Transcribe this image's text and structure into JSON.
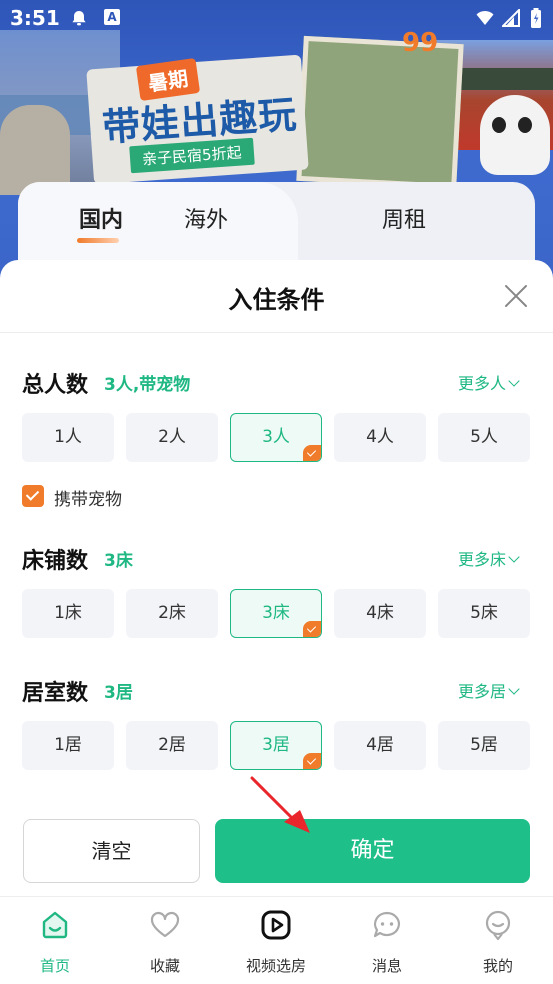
{
  "status_bar": {
    "time": "3:51",
    "a_icon_text": "A"
  },
  "banner": {
    "summer_tag": "暑期",
    "slogan": "带娃出趣玩",
    "sub_slogan": "亲子民宿5折起",
    "quote_mark": "99"
  },
  "tabs": [
    {
      "label": "国内",
      "active": true
    },
    {
      "label": "海外",
      "active": false
    },
    {
      "label": "周租",
      "active": false
    }
  ],
  "sheet": {
    "title": "入住条件",
    "sections": {
      "guests": {
        "title": "总人数",
        "value": "3人,带宠物",
        "more": "更多人",
        "options": [
          "1人",
          "2人",
          "3人",
          "4人",
          "5人"
        ],
        "selected_index": 2
      },
      "beds": {
        "title": "床铺数",
        "value": "3床",
        "more": "更多床",
        "options": [
          "1床",
          "2床",
          "3床",
          "4床",
          "5床"
        ],
        "selected_index": 2
      },
      "rooms": {
        "title": "居室数",
        "value": "3居",
        "more": "更多居",
        "options": [
          "1居",
          "2居",
          "3居",
          "4居",
          "5居"
        ],
        "selected_index": 2
      }
    },
    "pet": {
      "label": "携带宠物",
      "checked": true
    },
    "buttons": {
      "clear": "清空",
      "confirm": "确定"
    }
  },
  "bottom_nav": [
    {
      "label": "首页",
      "icon": "home-icon",
      "active": true
    },
    {
      "label": "收藏",
      "icon": "heart-icon",
      "active": false
    },
    {
      "label": "视频选房",
      "icon": "video-play-icon",
      "active": false
    },
    {
      "label": "消息",
      "icon": "message-icon",
      "active": false
    },
    {
      "label": "我的",
      "icon": "profile-icon",
      "active": false
    }
  ],
  "colors": {
    "accent_green": "#1fb883",
    "confirm_green": "#1fbf8a",
    "accent_orange": "#f07b2a",
    "banner_blue": "#2e55b8"
  }
}
